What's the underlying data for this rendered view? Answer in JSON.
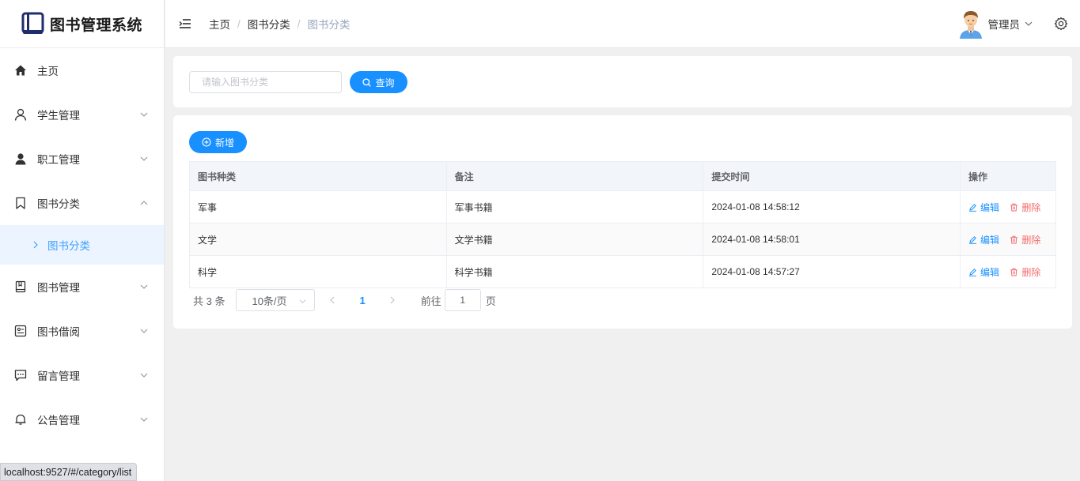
{
  "app": {
    "title": "图书管理系统"
  },
  "sidebar": {
    "items": [
      {
        "label": "主页",
        "icon": "home-icon",
        "expandable": false
      },
      {
        "label": "学生管理",
        "icon": "user-outline-icon",
        "expandable": true
      },
      {
        "label": "职工管理",
        "icon": "user-filled-icon",
        "expandable": true
      },
      {
        "label": "图书分类",
        "icon": "bookmark-icon",
        "expandable": true,
        "expanded": true
      },
      {
        "label": "图书管理",
        "icon": "book-icon",
        "expandable": true
      },
      {
        "label": "图书借阅",
        "icon": "tickets-icon",
        "expandable": true
      },
      {
        "label": "留言管理",
        "icon": "chat-icon",
        "expandable": true
      },
      {
        "label": "公告管理",
        "icon": "bell-icon",
        "expandable": true
      }
    ],
    "sub_item": {
      "label": "图书分类"
    }
  },
  "header": {
    "breadcrumb": [
      "主页",
      "图书分类",
      "图书分类"
    ],
    "user_name": "管理员"
  },
  "search": {
    "placeholder": "请输入图书分类",
    "button_label": "查询"
  },
  "toolbar": {
    "add_label": "新增"
  },
  "table": {
    "columns": [
      "图书种类",
      "备注",
      "提交时间",
      "操作"
    ],
    "rows": [
      {
        "category": "军事",
        "note": "军事书籍",
        "time": "2024-01-08 14:58:12"
      },
      {
        "category": "文学",
        "note": "文学书籍",
        "time": "2024-01-08 14:58:01"
      },
      {
        "category": "科学",
        "note": "科学书籍",
        "time": "2024-01-08 14:57:27"
      }
    ],
    "edit_label": "编辑",
    "delete_label": "删除"
  },
  "pagination": {
    "total_text": "共 3 条",
    "page_size": "10条/页",
    "current_page": "1",
    "goto_label": "前往",
    "goto_value": "1",
    "page_suffix": "页"
  },
  "status_bar": {
    "url": "localhost:9527/#/category/list"
  },
  "colors": {
    "primary": "#1890ff",
    "danger": "#f56c6c",
    "active_bg": "#ecf5ff"
  }
}
